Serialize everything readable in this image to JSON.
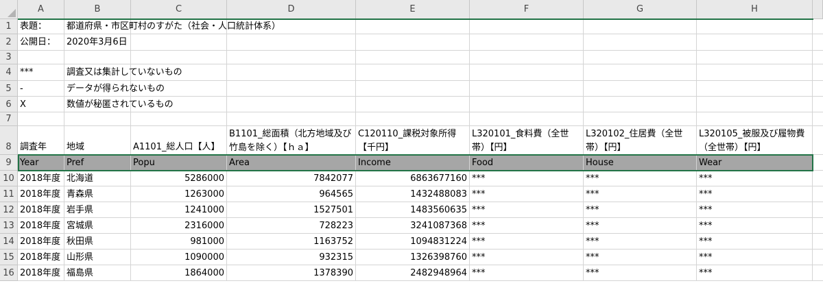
{
  "columns": [
    "A",
    "B",
    "C",
    "D",
    "E",
    "F",
    "G",
    "H"
  ],
  "rows": {
    "1": [
      "表題：",
      "都道府県・市区町村のすがた（社会・人口統計体系）",
      "",
      "",
      "",
      "",
      "",
      ""
    ],
    "2": [
      "公開日：",
      "2020年3月6日",
      "",
      "",
      "",
      "",
      "",
      ""
    ],
    "3": [
      "",
      "",
      "",
      "",
      "",
      "",
      "",
      ""
    ],
    "4": [
      "***",
      "調査又は集計していないもの",
      "",
      "",
      "",
      "",
      "",
      ""
    ],
    "5": [
      "-",
      "データが得られないもの",
      "",
      "",
      "",
      "",
      "",
      ""
    ],
    "6": [
      "X",
      "数値が秘匿されているもの",
      "",
      "",
      "",
      "",
      "",
      ""
    ],
    "7": [
      "",
      "",
      "",
      "",
      "",
      "",
      "",
      ""
    ],
    "8": [
      "調査年",
      "地域",
      "A1101_総人口【人】",
      "B1101_総面積（北方地域及び竹島を除く）【ｈａ】",
      "C120110_課税対象所得【千円】",
      "L320101_食料費（全世帯）【円】",
      "L320102_住居費（全世帯）【円】",
      "L320105_被服及び履物費（全世帯）【円】"
    ],
    "9": [
      "Year",
      "Pref",
      "Popu",
      "Area",
      "Income",
      "Food",
      "House",
      "Wear"
    ],
    "10": [
      "2018年度",
      "北海道",
      "5286000",
      "7842077",
      "6863677160",
      "***",
      "***",
      "***"
    ],
    "11": [
      "2018年度",
      "青森県",
      "1263000",
      "964565",
      "1432488083",
      "***",
      "***",
      "***"
    ],
    "12": [
      "2018年度",
      "岩手県",
      "1241000",
      "1527501",
      "1483560635",
      "***",
      "***",
      "***"
    ],
    "13": [
      "2018年度",
      "宮城県",
      "2316000",
      "728223",
      "3241087368",
      "***",
      "***",
      "***"
    ],
    "14": [
      "2018年度",
      "秋田県",
      "981000",
      "1163752",
      "1094831224",
      "***",
      "***",
      "***"
    ],
    "15": [
      "2018年度",
      "山形県",
      "1090000",
      "932315",
      "1326398760",
      "***",
      "***",
      "***"
    ],
    "16": [
      "2018年度",
      "福島県",
      "1864000",
      "1378390",
      "2482948964",
      "***",
      "***",
      "***"
    ]
  },
  "colors": {
    "selection_border": "#217346",
    "selected_row_fill": "#a6a6a6",
    "header_fill": "#e9e9e9"
  }
}
